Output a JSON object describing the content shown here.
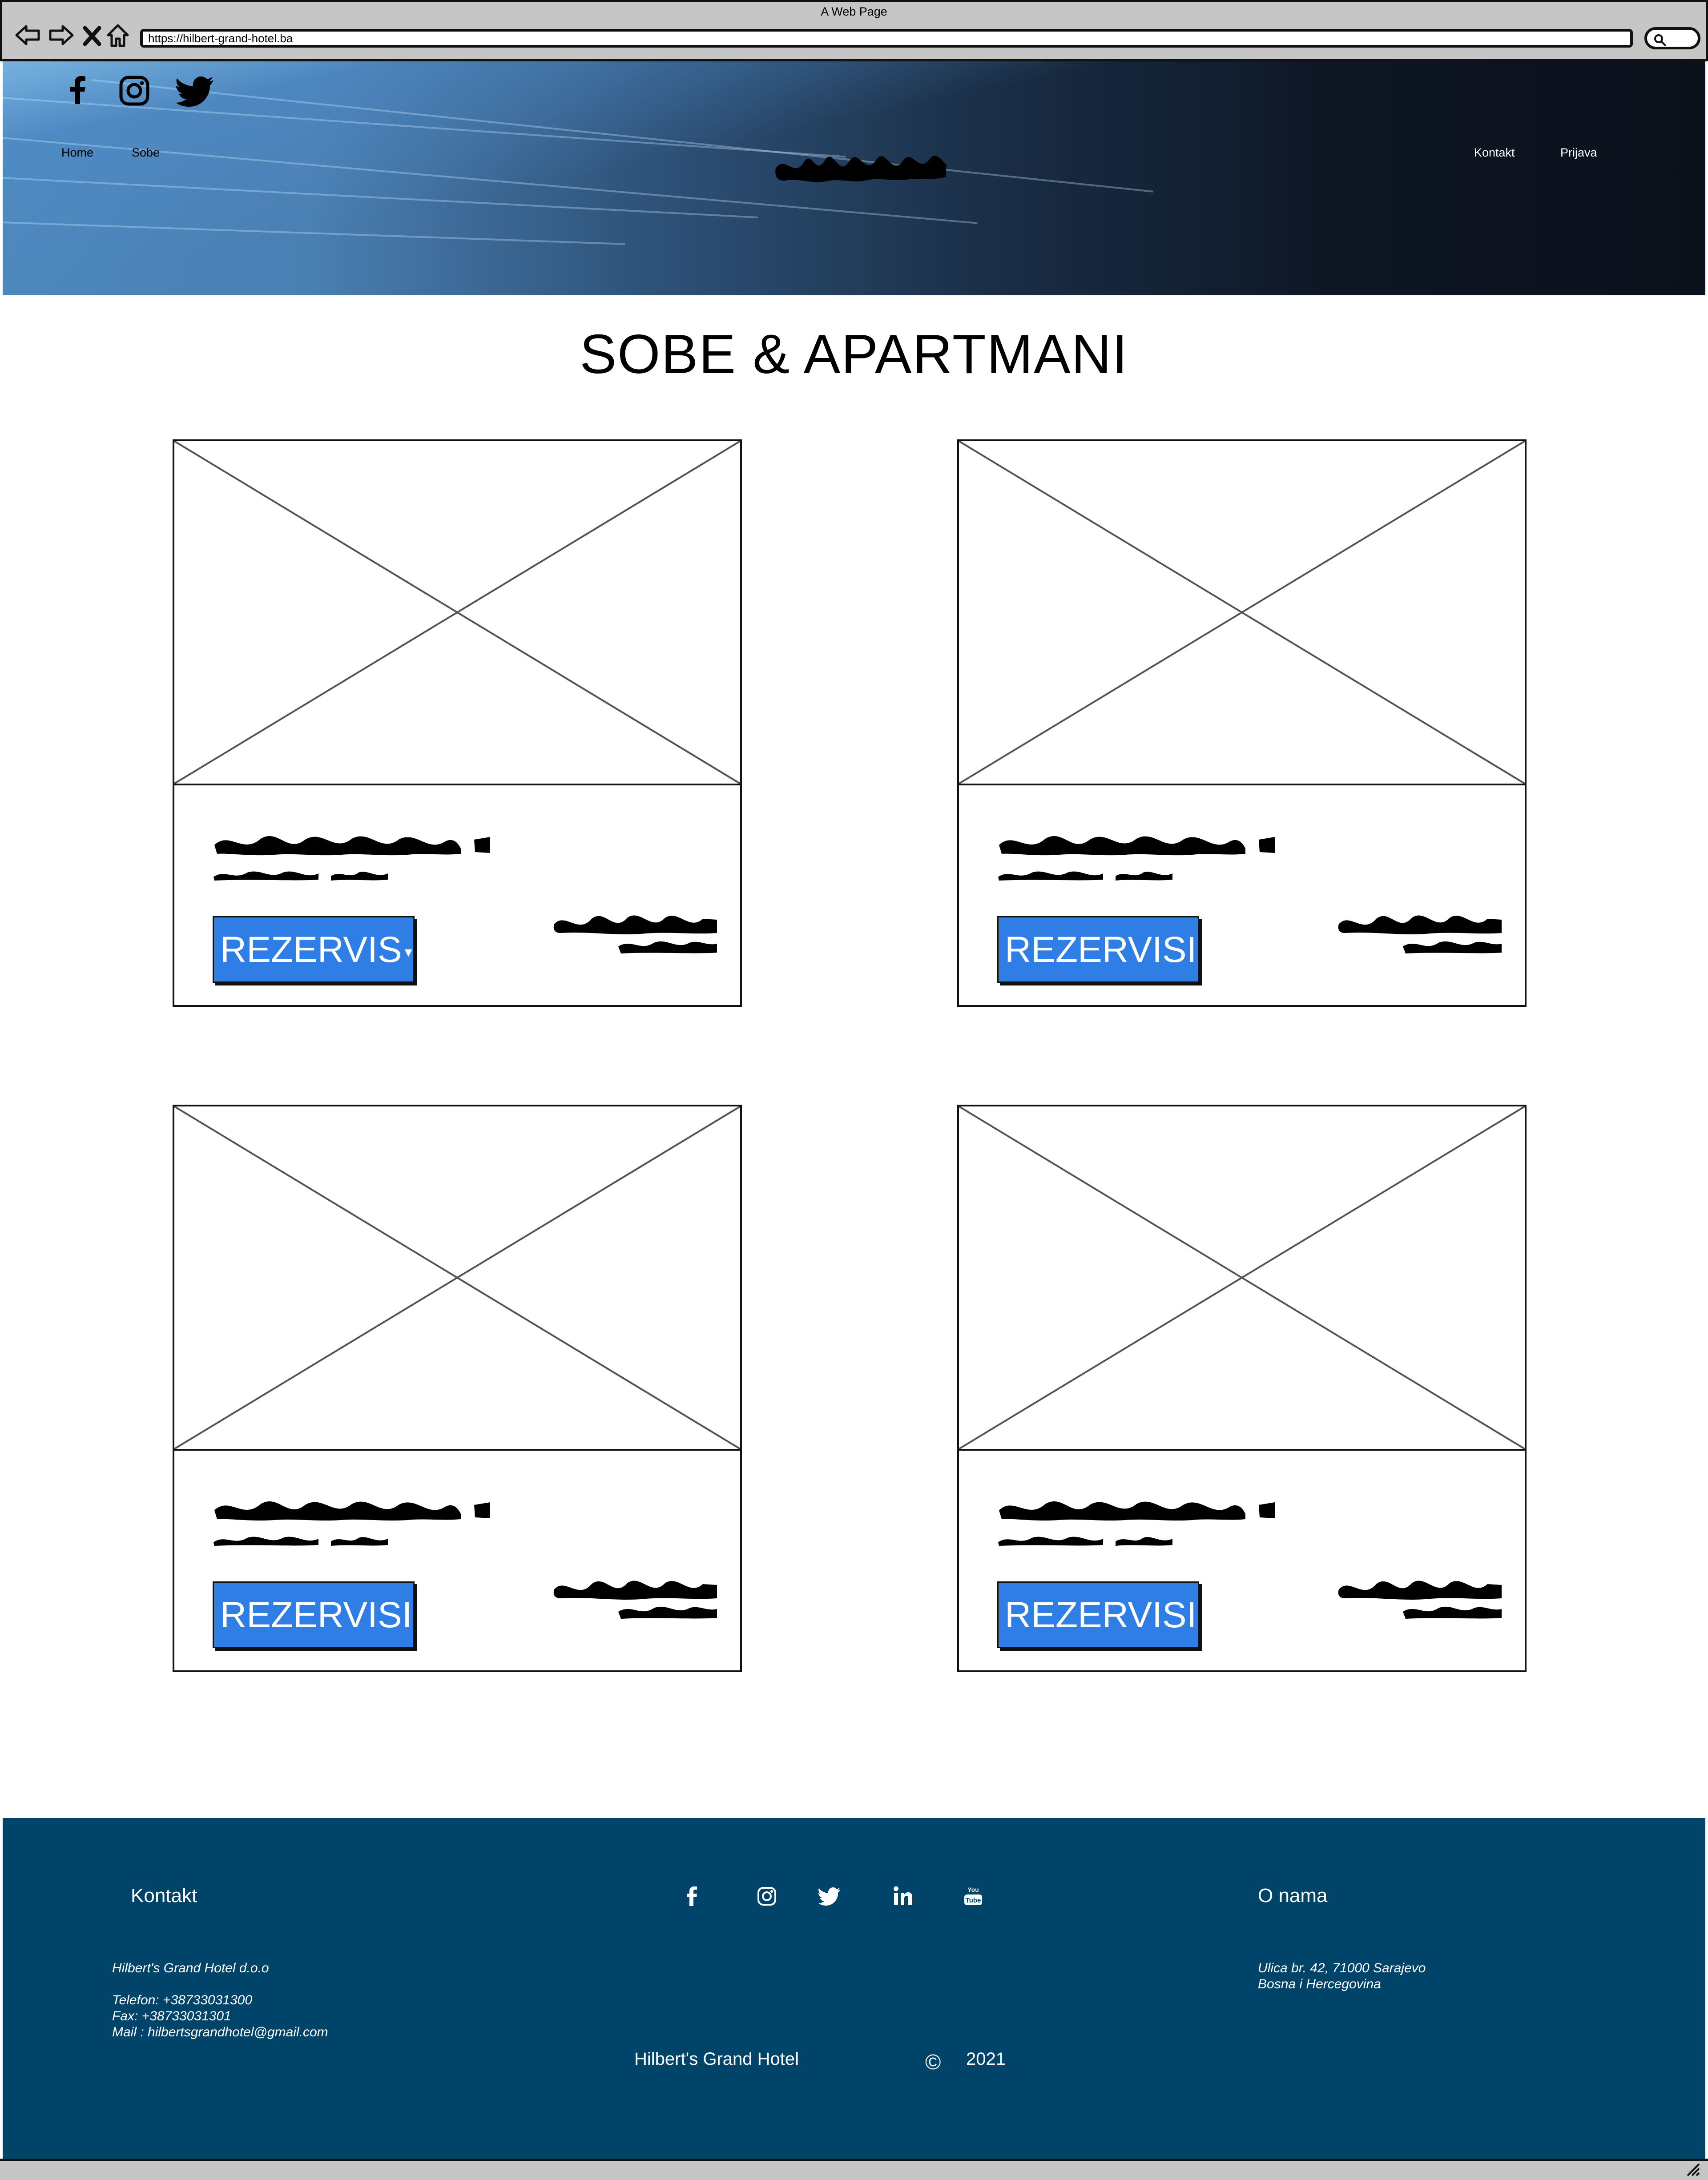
{
  "browser": {
    "title": "A Web Page",
    "url": "https://hilbert-grand-hotel.ba",
    "icons": [
      "back-arrow-icon",
      "forward-arrow-icon",
      "close-icon",
      "home-icon",
      "search-icon"
    ]
  },
  "header": {
    "social_icons": [
      "facebook-icon",
      "instagram-icon",
      "twitter-icon"
    ],
    "nav_left": [
      "Home",
      "Sobe"
    ],
    "nav_right": [
      "Kontakt",
      "Prijava"
    ]
  },
  "main": {
    "title": "SOBE & APARTMANI",
    "cards": [
      {
        "button_label": "REZERVIS",
        "has_dropdown": true
      },
      {
        "button_label": "REZERVISI",
        "has_dropdown": false
      },
      {
        "button_label": "REZERVISI",
        "has_dropdown": false
      },
      {
        "button_label": "REZERVISI",
        "has_dropdown": false
      }
    ]
  },
  "footer": {
    "contact_heading": "Kontakt",
    "contact_lines": {
      "company": "Hilbert's Grand Hotel d.o.o",
      "phone": "Telefon: +38733031300",
      "fax": "Fax: +38733031301",
      "mail": "Mail : hilbertsgrandhotel@gmail.com"
    },
    "social_icons": [
      "facebook-icon",
      "instagram-icon",
      "twitter-icon",
      "linkedin-icon",
      "youtube-icon"
    ],
    "about_heading": "O nama",
    "address_line1": "Ulica br. 42, 71000 Sarajevo",
    "address_line2": "Bosna i Hercegovina",
    "brand": "Hilbert's Grand Hotel",
    "copyright_symbol": "©",
    "year": "2021"
  },
  "colors": {
    "button_blue": "#2f7ee6",
    "footer_bg": "#004569",
    "chrome_gray": "#c6c6c6"
  }
}
